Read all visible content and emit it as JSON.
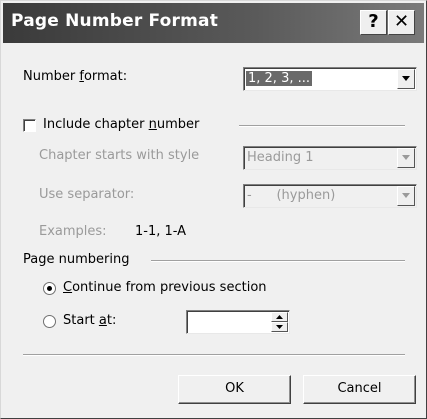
{
  "dialog": {
    "title": "Page Number Format",
    "help_glyph": "?",
    "close_glyph": "✕"
  },
  "number_format": {
    "label_pre": "Number ",
    "label_mnemonic": "f",
    "label_post": "ormat:",
    "value": "1, 2, 3, ..."
  },
  "chapter": {
    "checkbox_pre": "Include chapter ",
    "checkbox_mnemonic": "n",
    "checkbox_post": "umber",
    "checked": false,
    "starts_with_label": "Chapter starts with style",
    "starts_with_value": "Heading 1",
    "separator_label": "Use separator:",
    "separator_value": "-      (hyphen)",
    "examples_label": "Examples:",
    "examples_value": "1-1, 1-A"
  },
  "page_numbering": {
    "heading": "Page numbering",
    "continue_mnemonic": "C",
    "continue_post": "ontinue from previous section",
    "continue_selected": true,
    "start_pre": "Start ",
    "start_mnemonic": "a",
    "start_post": "t:",
    "start_value": ""
  },
  "buttons": {
    "ok": "OK",
    "cancel": "Cancel"
  },
  "icons": [
    "help-icon",
    "close-icon",
    "chevron-down-icon",
    "spin-up-icon",
    "spin-down-icon"
  ]
}
